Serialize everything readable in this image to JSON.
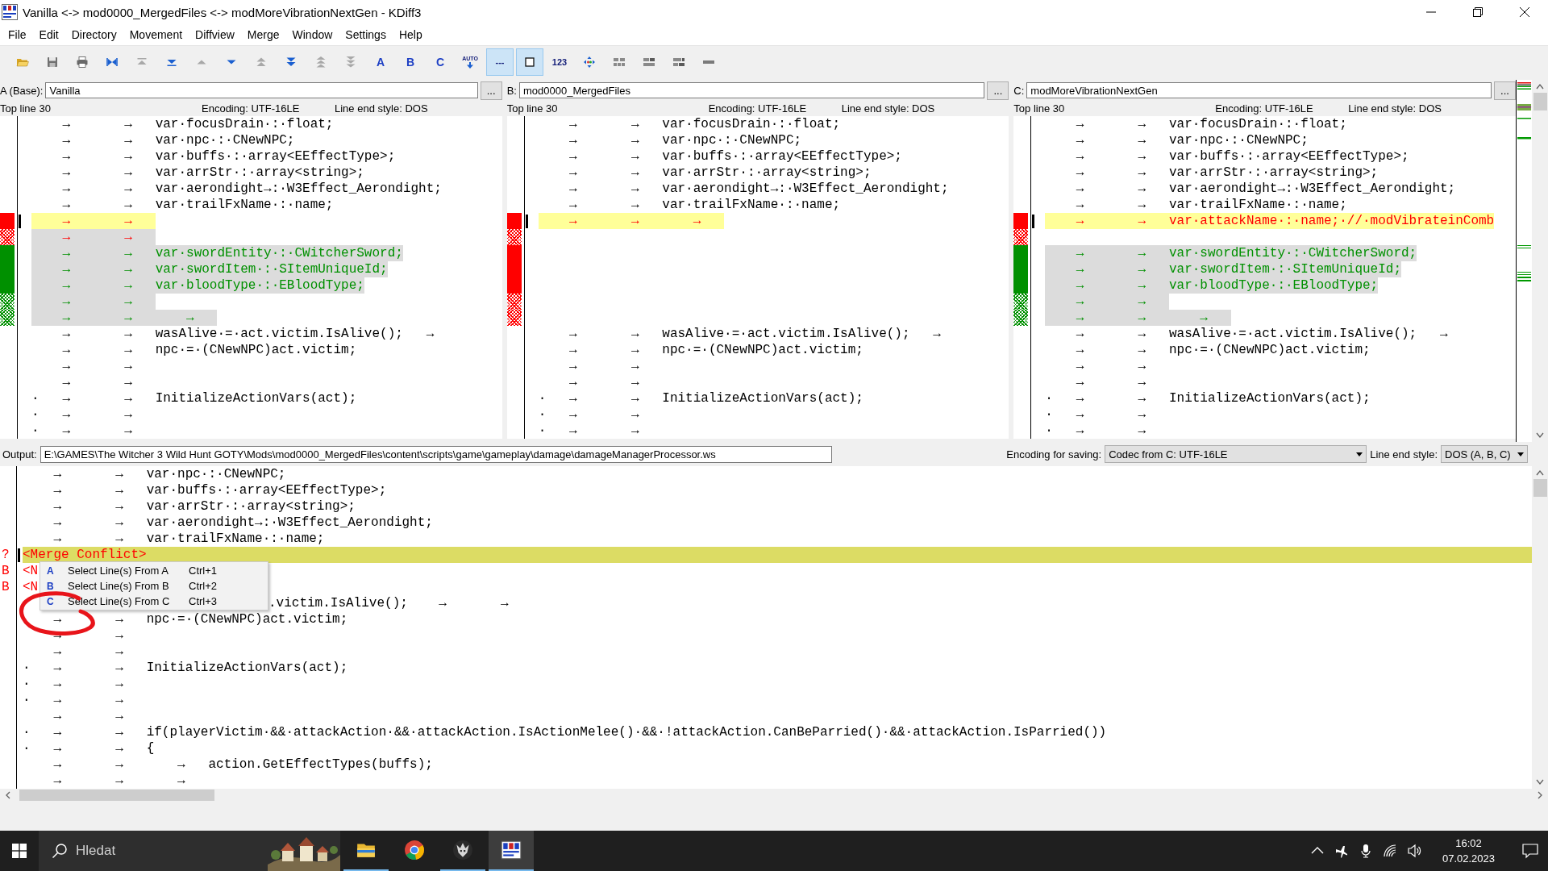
{
  "window": {
    "title": "Vanilla <-> mod0000_MergedFiles <-> modMoreVibrationNextGen - KDiff3"
  },
  "menu": [
    "File",
    "Edit",
    "Directory",
    "Movement",
    "Diffview",
    "Merge",
    "Window",
    "Settings",
    "Help"
  ],
  "toolbar": [
    {
      "kind": "folder",
      "on": false
    },
    {
      "kind": "save",
      "on": false
    },
    {
      "kind": "print",
      "on": false
    },
    {
      "kind": "bowtie",
      "on": false,
      "disabled": false
    },
    {
      "kind": "first",
      "on": false,
      "disabled": true
    },
    {
      "kind": "last",
      "on": false,
      "disabled": false
    },
    {
      "kind": "up",
      "on": false,
      "disabled": true
    },
    {
      "kind": "down",
      "on": false,
      "disabled": false
    },
    {
      "kind": "double-up",
      "on": false,
      "disabled": true
    },
    {
      "kind": "double-down",
      "on": false,
      "disabled": false
    },
    {
      "kind": "triple-up",
      "on": false,
      "disabled": true
    },
    {
      "kind": "triple-down",
      "on": false,
      "disabled": true
    },
    {
      "kind": "letter",
      "label": "A",
      "on": false
    },
    {
      "kind": "letter",
      "label": "B",
      "on": false
    },
    {
      "kind": "letter",
      "label": "C",
      "on": false
    },
    {
      "kind": "label-arrow",
      "label": "AUTO",
      "on": false
    },
    {
      "kind": "label",
      "label": "---",
      "on": true
    },
    {
      "kind": "square",
      "on": true
    },
    {
      "kind": "label",
      "label": "123",
      "on": false
    },
    {
      "kind": "diamond",
      "on": false,
      "disabled": false
    },
    {
      "kind": "grid-1",
      "on": false
    },
    {
      "kind": "grid-2",
      "on": false
    },
    {
      "kind": "grid-3",
      "on": false
    },
    {
      "kind": "bar",
      "on": false
    }
  ],
  "panes": [
    {
      "label": "A (Base):",
      "file": "Vanilla",
      "browse": "...",
      "top_line": "Top line 30",
      "encoding": "Encoding: UTF-16LE",
      "line_end": "Line end style: DOS",
      "lines": [
        {
          "kind": "same",
          "text": "    →       →   var·focusDrain·:·float;"
        },
        {
          "kind": "same",
          "text": "    →       →   var·npc·:·CNewNPC;"
        },
        {
          "kind": "same",
          "text": "    →       →   var·buffs·:·array<EEffectType>;"
        },
        {
          "kind": "same",
          "text": "    →       →   var·arrStr·:·array<string>;"
        },
        {
          "kind": "same",
          "text": "    →       →   var·aerondight→:·W3Effect_Aerondight;"
        },
        {
          "kind": "same",
          "text": "    →       →   var·trailFxName·:·name;"
        },
        {
          "kind": "conflict",
          "color": "#ff0000",
          "hatched": false,
          "text": "    →       →   "
        },
        {
          "kind": "removed",
          "color": "#ff0000",
          "hatched": true,
          "text": "    →       →   "
        },
        {
          "kind": "added",
          "color": "#009000",
          "hatched": false,
          "text": "    →       →   var·swordEntity·:·CWitcherSword;"
        },
        {
          "kind": "added",
          "color": "#009000",
          "hatched": false,
          "text": "    →       →   var·swordItem·:·SItemUniqueId;"
        },
        {
          "kind": "added",
          "color": "#009000",
          "hatched": false,
          "text": "    →       →   var·bloodType·:·EBloodType;"
        },
        {
          "kind": "added",
          "color": "#009000",
          "hatched": true,
          "text": "    →       →   "
        },
        {
          "kind": "added",
          "color": "#009000",
          "hatched": true,
          "text": "    →       →       →   "
        },
        {
          "kind": "same",
          "text": "    →       →   wasAlive·=·act.victim.IsAlive();   →"
        },
        {
          "kind": "same",
          "text": "    →       →   npc·=·(CNewNPC)act.victim;"
        },
        {
          "kind": "same",
          "text": "    →       →"
        },
        {
          "kind": "same",
          "text": "    →       →"
        },
        {
          "kind": "same",
          "text": "·   →       →   InitializeActionVars(act);"
        },
        {
          "kind": "same",
          "text": "·   →       →"
        },
        {
          "kind": "same",
          "text": "·   →       →"
        }
      ]
    },
    {
      "label": "B:",
      "file": "mod0000_MergedFiles",
      "browse": "...",
      "top_line": "Top line 30",
      "encoding": "Encoding: UTF-16LE",
      "line_end": "Line end style: DOS",
      "lines": [
        {
          "kind": "same",
          "text": "    →       →   var·focusDrain·:·float;"
        },
        {
          "kind": "same",
          "text": "    →       →   var·npc·:·CNewNPC;"
        },
        {
          "kind": "same",
          "text": "    →       →   var·buffs·:·array<EEffectType>;"
        },
        {
          "kind": "same",
          "text": "    →       →   var·arrStr·:·array<string>;"
        },
        {
          "kind": "same",
          "text": "    →       →   var·aerondight→:·W3Effect_Aerondight;"
        },
        {
          "kind": "same",
          "text": "    →       →   var·trailFxName·:·name;"
        },
        {
          "kind": "conflict",
          "color": "#ff0000",
          "hatched": false,
          "text": "    →       →       →   "
        },
        {
          "kind": "blank",
          "color": "#ff0000",
          "hatched": true
        },
        {
          "kind": "blank",
          "color": "#ff0000",
          "hatched": false
        },
        {
          "kind": "blank",
          "color": "#ff0000",
          "hatched": false
        },
        {
          "kind": "blank",
          "color": "#ff0000",
          "hatched": false
        },
        {
          "kind": "blank",
          "color": "#ff0000",
          "hatched": true
        },
        {
          "kind": "blank",
          "color": "#ff0000",
          "hatched": true
        },
        {
          "kind": "same",
          "text": "    →       →   wasAlive·=·act.victim.IsAlive();   →"
        },
        {
          "kind": "same",
          "text": "    →       →   npc·=·(CNewNPC)act.victim;"
        },
        {
          "kind": "same",
          "text": "    →       →"
        },
        {
          "kind": "same",
          "text": "    →       →"
        },
        {
          "kind": "same",
          "text": "·   →       →   InitializeActionVars(act);"
        },
        {
          "kind": "same",
          "text": "·   →       →"
        },
        {
          "kind": "same",
          "text": "·   →       →"
        }
      ]
    },
    {
      "label": "C:",
      "file": "modMoreVibrationNextGen",
      "browse": "...",
      "top_line": "Top line 30",
      "encoding": "Encoding: UTF-16LE",
      "line_end": "Line end style: DOS",
      "lines": [
        {
          "kind": "same",
          "text": "    →       →   var·focusDrain·:·float;"
        },
        {
          "kind": "same",
          "text": "    →       →   var·npc·:·CNewNPC;"
        },
        {
          "kind": "same",
          "text": "    →       →   var·buffs·:·array<EEffectType>;"
        },
        {
          "kind": "same",
          "text": "    →       →   var·arrStr·:·array<string>;"
        },
        {
          "kind": "same",
          "text": "    →       →   var·aerondight→:·W3Effect_Aerondight;"
        },
        {
          "kind": "same",
          "text": "    →       →   var·trailFxName·:·name;"
        },
        {
          "kind": "conflict",
          "color": "#ff0000",
          "hatched": false,
          "text": "    →       →   var·attackName·:·name;·//·modVibrateinComb"
        },
        {
          "kind": "blank",
          "color": "#ff0000",
          "hatched": true
        },
        {
          "kind": "added",
          "color": "#009000",
          "hatched": false,
          "text": "    →       →   var·swordEntity·:·CWitcherSword;"
        },
        {
          "kind": "added",
          "color": "#009000",
          "hatched": false,
          "text": "    →       →   var·swordItem·:·SItemUniqueId;"
        },
        {
          "kind": "added",
          "color": "#009000",
          "hatched": false,
          "text": "    →       →   var·bloodType·:·EBloodType;"
        },
        {
          "kind": "added",
          "color": "#009000",
          "hatched": true,
          "text": "    →       →   "
        },
        {
          "kind": "added",
          "color": "#009000",
          "hatched": true,
          "text": "    →       →       →   "
        },
        {
          "kind": "same",
          "text": "    →       →   wasAlive·=·act.victim.IsAlive();   →"
        },
        {
          "kind": "same",
          "text": "    →       →   npc·=·(CNewNPC)act.victim;"
        },
        {
          "kind": "same",
          "text": "    →       →"
        },
        {
          "kind": "same",
          "text": "    →       →"
        },
        {
          "kind": "same",
          "text": "·   →       →   InitializeActionVars(act);"
        },
        {
          "kind": "same",
          "text": "·   →       →"
        },
        {
          "kind": "same",
          "text": "·   →       →"
        }
      ]
    }
  ],
  "output": {
    "label": "Output:",
    "path": "E:\\GAMES\\The Witcher 3 Wild Hunt GOTY\\Mods\\mod0000_MergedFiles\\content\\scripts\\game\\gameplay\\damage\\damageManagerProcessor.ws",
    "encoding_label": "Encoding for saving:",
    "encoding": "Codec from C: UTF-16LE",
    "line_end_label": "Line end style:",
    "line_end": "DOS (A, B, C)",
    "lines": [
      {
        "kind": "same",
        "text": "    →       →   var·npc·:·CNewNPC;"
      },
      {
        "kind": "same",
        "text": "    →       →   var·buffs·:·array<EEffectType>;"
      },
      {
        "kind": "same",
        "text": "    →       →   var·arrStr·:·array<string>;"
      },
      {
        "kind": "same",
        "text": "    →       →   var·aerondight→:·W3Effect_Aerondight;"
      },
      {
        "kind": "same",
        "text": "    →       →   var·trailFxName·:·name;"
      },
      {
        "kind": "conflict",
        "flag": "?",
        "text": "<Merge Conflict>"
      },
      {
        "kind": "unsolved",
        "flag": "B",
        "text": "<N"
      },
      {
        "kind": "unsolved",
        "flag": "B",
        "text": "<N"
      },
      {
        "kind": "covered",
        "text": ".victim.IsAlive();    →       →"
      },
      {
        "kind": "same",
        "text": "    →       →   npc·=·(CNewNPC)act.victim;"
      },
      {
        "kind": "same",
        "text": "    →       →"
      },
      {
        "kind": "same",
        "text": "    →       →"
      },
      {
        "kind": "same",
        "text": "·   →       →   InitializeActionVars(act);"
      },
      {
        "kind": "same",
        "text": "·   →       →"
      },
      {
        "kind": "same",
        "text": "·   →       →"
      },
      {
        "kind": "same",
        "text": "    →       →"
      },
      {
        "kind": "same",
        "text": "·   →       →   if(playerVictim·&&·attackAction·&&·attackAction.IsActionMelee()·&&·!attackAction.CanBeParried()·&&·attackAction.IsParried())"
      },
      {
        "kind": "same",
        "text": "·   →       →   {"
      },
      {
        "kind": "same",
        "text": "    →       →       →   action.GetEffectTypes(buffs);"
      },
      {
        "kind": "same",
        "text": "    →       →       →"
      }
    ]
  },
  "context_menu": {
    "items": [
      {
        "icon": "A",
        "label": "Select Line(s) From A",
        "shortcut": "Ctrl+1"
      },
      {
        "icon": "B",
        "label": "Select Line(s) From B",
        "shortcut": "Ctrl+2"
      },
      {
        "icon": "C",
        "label": "Select Line(s) From C",
        "shortcut": "Ctrl+3"
      }
    ]
  },
  "taskbar": {
    "search": {
      "placeholder": "Hledat"
    },
    "apps": [
      {
        "kind": "explorer",
        "running": true,
        "selected": false
      },
      {
        "kind": "browser",
        "running": false,
        "selected": false
      },
      {
        "kind": "game",
        "running": true,
        "selected": false
      },
      {
        "kind": "kdiff",
        "running": true,
        "selected": true
      }
    ],
    "time": "16:02",
    "date": "07.02.2023"
  }
}
